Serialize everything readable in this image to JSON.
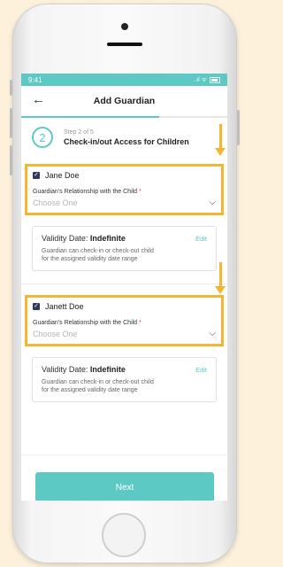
{
  "status": {
    "time": "9:41",
    "icons": "..ıl ᯤ"
  },
  "nav": {
    "back_icon": "←",
    "title": "Add Guardian",
    "progress_fraction": 0.67
  },
  "step": {
    "number": "2",
    "small": "Step 2 of 5",
    "title": "Check-in/out Access for Children"
  },
  "guardians": [
    {
      "name": "Jane Doe",
      "relationship_label": "Guardian's Relationship with the Child",
      "required_mark": "*",
      "placeholder": "Choose One",
      "validity_label": "Validity Date:",
      "validity_value": "Indefinite",
      "edit": "Edit",
      "desc1": "Guardian can check-in or check-out child",
      "desc2": "for the assigned validity date range"
    },
    {
      "name": "Janett Doe",
      "relationship_label": "Guardian's Relationship with the Child",
      "required_mark": "*",
      "placeholder": "Choose One",
      "validity_label": "Validity Date:",
      "validity_value": "Indefinite",
      "edit": "Edit",
      "desc1": "Guardian can check-in or check-out child",
      "desc2": "for the assigned validity date range"
    }
  ],
  "footer": {
    "next": "Next"
  },
  "colors": {
    "accent": "#5cc9c4",
    "highlight": "#f2b632",
    "checkbox": "#2f3a5c",
    "background": "#fdf1dc"
  }
}
